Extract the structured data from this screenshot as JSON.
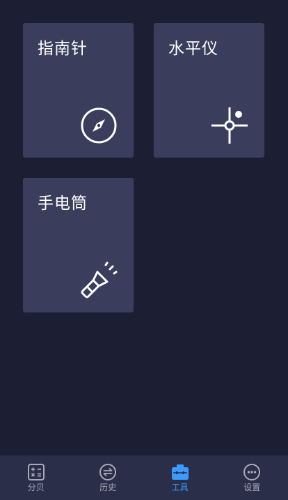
{
  "tools": {
    "compass_label": "指南针",
    "level_label": "水平仪",
    "flashlight_label": "手电筒"
  },
  "tabbar": {
    "items": [
      {
        "label": "分贝",
        "icon": "calculator-icon",
        "active": false
      },
      {
        "label": "历史",
        "icon": "history-icon",
        "active": false
      },
      {
        "label": "工具",
        "icon": "toolbox-icon",
        "active": true
      },
      {
        "label": "设置",
        "icon": "more-icon",
        "active": false
      }
    ],
    "active_color": "#3b9bff",
    "inactive_color": "#a7aab9"
  },
  "colors": {
    "background": "#1c1f34",
    "card": "#3a3e5c",
    "tabbar": "#2a2e49"
  }
}
